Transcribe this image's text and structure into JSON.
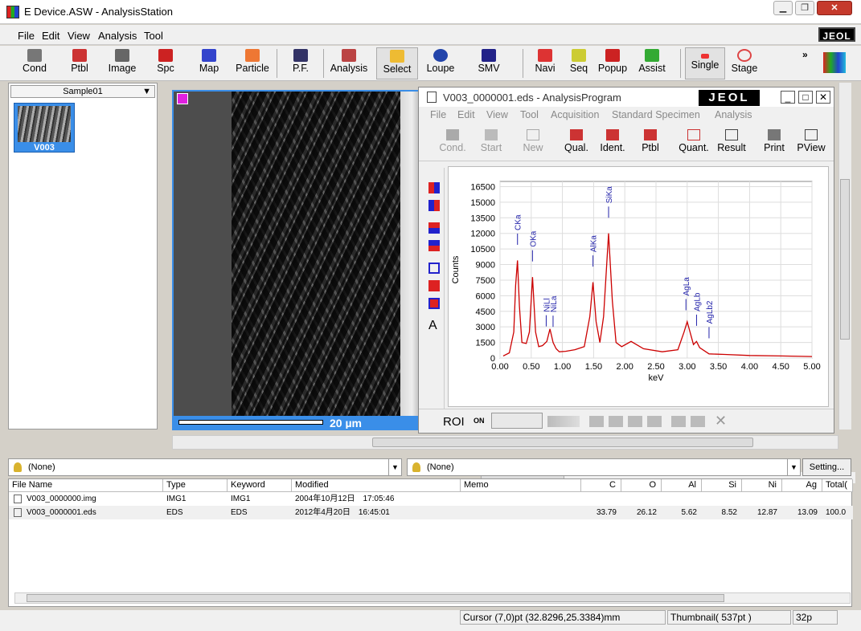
{
  "window": {
    "title": "E Device.ASW - AnalysisStation",
    "min_label": "▁",
    "max_label": "❐",
    "close_label": "✕"
  },
  "menu": {
    "items": [
      "File",
      "Edit",
      "View",
      "Analysis",
      "Tool"
    ],
    "logo": "JEOL"
  },
  "toolbar": {
    "buttons": [
      "Cond",
      "Ptbl",
      "Image",
      "Spc",
      "Map",
      "Particle",
      "P.F.",
      "Analysis",
      "Select",
      "Loupe",
      "SMV",
      "Navi",
      "Seq",
      "Popup",
      "Assist",
      "Single",
      "Stage"
    ],
    "overflow": "»"
  },
  "sample_panel": {
    "dropdown": "Sample01",
    "thumbnail_label": "V003"
  },
  "image_viewer": {
    "scale_label": "20 µm"
  },
  "analysis_window": {
    "title": "V003_0000001.eds - AnalysisProgram",
    "logo": "JEOL",
    "menu": [
      "File",
      "Edit",
      "View",
      "Tool",
      "Acquisition",
      "Standard Specimen",
      "Analysis"
    ],
    "toolbar": [
      "Cond.",
      "Start",
      "New",
      "Qual.",
      "Ident.",
      "Ptbl",
      "Quant.",
      "Result",
      "Print",
      "PView"
    ],
    "text_tool": "A",
    "roi_label": "ROI",
    "roi_state": "ON"
  },
  "chart_data": {
    "type": "line",
    "xlabel": "keV",
    "ylabel": "Counts",
    "xlim": [
      0,
      5
    ],
    "ylim": [
      0,
      17000
    ],
    "x_ticks": [
      "0.00",
      "0.50",
      "1.00",
      "1.50",
      "2.00",
      "2.50",
      "3.00",
      "3.50",
      "4.00",
      "4.50",
      "5.00"
    ],
    "y_ticks": [
      "0",
      "1500",
      "3000",
      "4500",
      "6000",
      "7500",
      "9000",
      "10500",
      "12000",
      "13500",
      "15000",
      "16500"
    ],
    "series": [
      {
        "color": "#cc0000",
        "x": [
          0.05,
          0.15,
          0.22,
          0.25,
          0.28,
          0.31,
          0.35,
          0.42,
          0.47,
          0.52,
          0.57,
          0.62,
          0.68,
          0.75,
          0.8,
          0.85,
          0.9,
          0.95,
          1.05,
          1.2,
          1.35,
          1.44,
          1.49,
          1.54,
          1.6,
          1.66,
          1.74,
          1.8,
          1.86,
          1.95,
          2.1,
          2.3,
          2.6,
          2.85,
          2.95,
          3.0,
          3.05,
          3.1,
          3.15,
          3.2,
          3.35,
          3.6,
          4.0,
          4.5,
          5.0
        ],
        "y": [
          200,
          500,
          2500,
          7000,
          9400,
          5000,
          1500,
          1400,
          2500,
          7800,
          2500,
          1100,
          1200,
          1600,
          2800,
          1500,
          900,
          600,
          650,
          800,
          1100,
          4000,
          7300,
          3500,
          1500,
          4000,
          12000,
          5500,
          1500,
          1100,
          1600,
          900,
          600,
          800,
          2500,
          3500,
          2400,
          1300,
          1600,
          1000,
          400,
          350,
          250,
          200,
          150
        ]
      }
    ],
    "annotations": [
      {
        "label": "CKa",
        "x": 0.28
      },
      {
        "label": "OKa",
        "x": 0.52
      },
      {
        "label": "NiLl",
        "x": 0.74
      },
      {
        "label": "NiLa",
        "x": 0.85
      },
      {
        "label": "AlKa",
        "x": 1.49
      },
      {
        "label": "SiKa",
        "x": 1.74
      },
      {
        "label": "AgLa",
        "x": 2.98
      },
      {
        "label": "AgLb",
        "x": 3.15
      },
      {
        "label": "AgLb2",
        "x": 3.35
      }
    ]
  },
  "filters": {
    "left": "(None)",
    "right": "(None)",
    "settings": "Setting..."
  },
  "table": {
    "columns": [
      "File Name",
      "Type",
      "Keyword",
      "Modified",
      "Memo",
      "C",
      "O",
      "Al",
      "Si",
      "Ni",
      "Ag",
      "Total("
    ],
    "rows": [
      {
        "name": "V003_0000000.img",
        "type": "IMG1",
        "keyword": "IMG1",
        "modified": "2004年10月12日　17:05:46",
        "memo": "",
        "C": "",
        "O": "",
        "Al": "",
        "Si": "",
        "Ni": "",
        "Ag": "",
        "Total": ""
      },
      {
        "name": "V003_0000001.eds",
        "type": "EDS",
        "keyword": "EDS",
        "modified": "2012年4月20日　16:45:01",
        "memo": "",
        "C": "33.79",
        "O": "26.12",
        "Al": "5.62",
        "Si": "8.52",
        "Ni": "12.87",
        "Ag": "13.09",
        "Total": "100.0"
      }
    ]
  },
  "status": {
    "cursor": "Cursor (7,0)pt (32.8296,25.3384)mm",
    "thumbnail": "Thumbnail( 537pt )",
    "size": "32p"
  }
}
